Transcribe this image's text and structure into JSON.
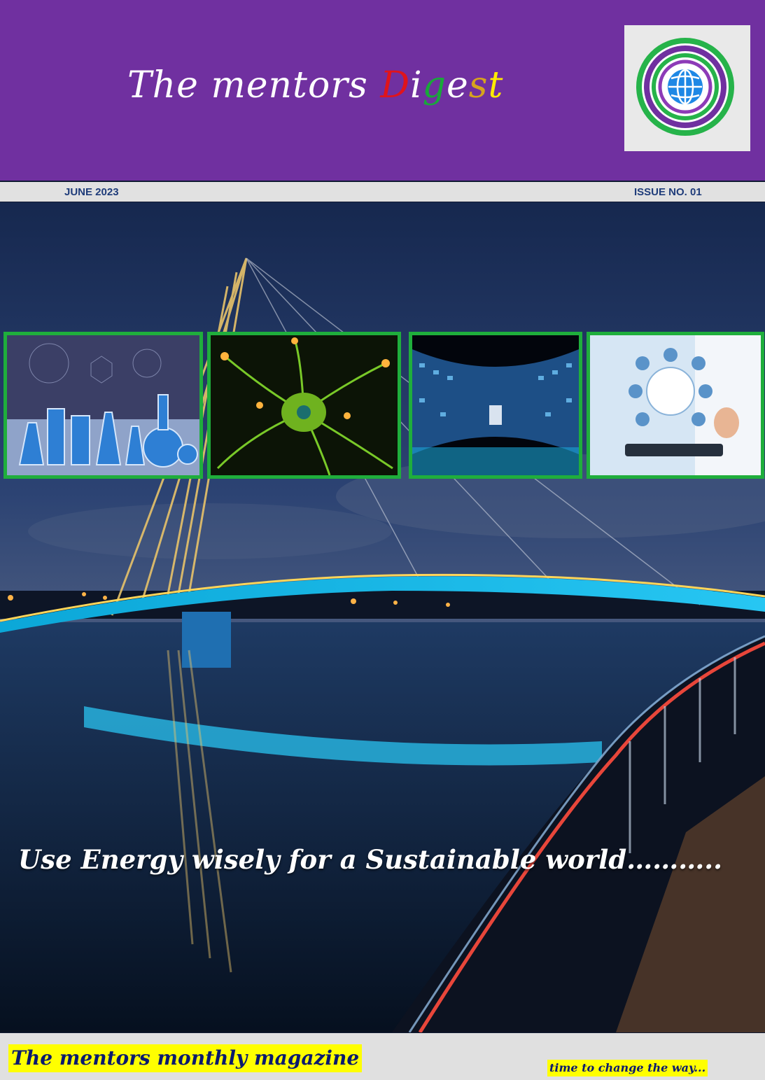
{
  "masthead": {
    "title_prefix": "The mentors ",
    "title_word_letters": [
      "D",
      "i",
      "g",
      "e",
      "s",
      "t"
    ]
  },
  "issue": {
    "date": "JUNE 2023",
    "number": "ISSUE NO. 01"
  },
  "hero": {
    "tagline": "Use Energy wisely for a Sustainable world……….."
  },
  "feature_tiles": [
    {
      "icon": "chemistry-flasks-image"
    },
    {
      "icon": "neuron-image"
    },
    {
      "icon": "digital-screens-tunnel-image"
    },
    {
      "icon": "medical-technology-image"
    }
  ],
  "footer": {
    "magazine_label": "The mentors monthly magazine",
    "motto": "time to change the way..."
  },
  "colors": {
    "header_purple": "#7030a0",
    "tile_border_green": "#1fae3c",
    "highlight_yellow": "#ffff00",
    "date_blue": "#1f3c7a"
  }
}
